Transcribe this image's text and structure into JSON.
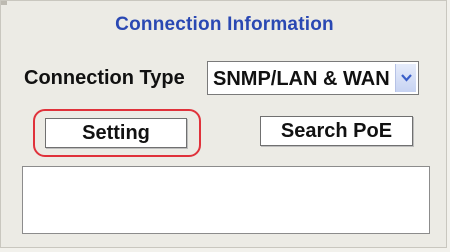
{
  "panel": {
    "title": "Connection Information",
    "connection_type_label": "Connection Type",
    "connection_type_value": "SNMP/LAN & WAN",
    "setting_button": "Setting",
    "search_poe_button": "Search PoE"
  },
  "colors": {
    "title": "#2a48b3",
    "highlight": "#e0323b",
    "panel_bg": "#ecebe5"
  },
  "icons": {
    "dropdown": "chevron-down-icon"
  }
}
